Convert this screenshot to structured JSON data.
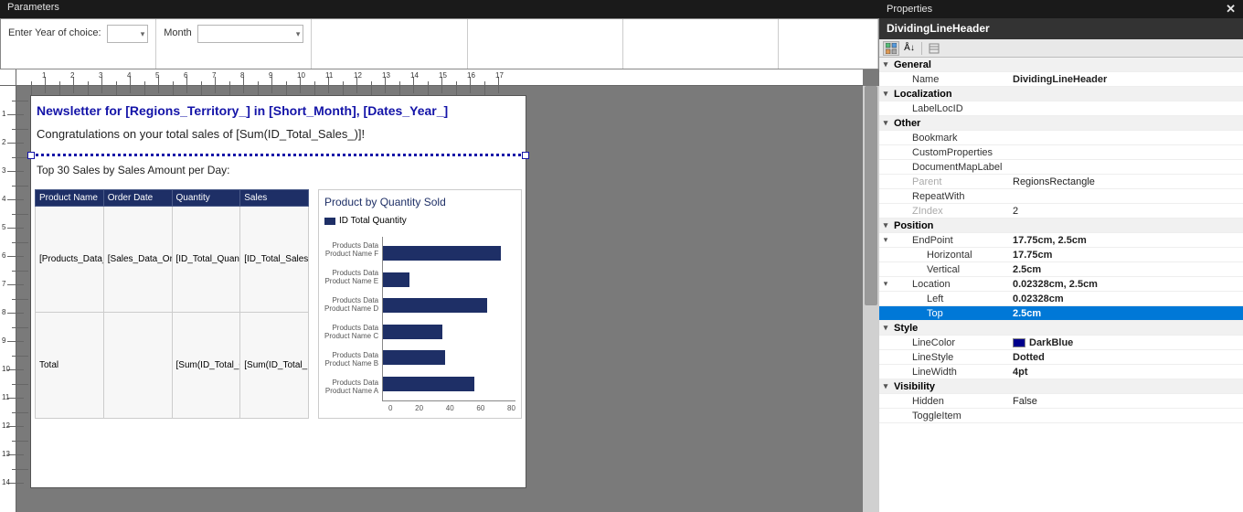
{
  "header": {
    "parameters": "Parameters",
    "properties": "Properties"
  },
  "propertiesObject": "DividingLineHeader",
  "params": [
    {
      "label": "Enter Year of choice:",
      "value": ""
    },
    {
      "label": "Month",
      "value": ""
    }
  ],
  "page": {
    "title": "Newsletter for [Regions_Territory_] in [Short_Month], [Dates_Year_]",
    "congrats": "Congratulations on your total sales of [Sum(ID_Total_Sales_)]!",
    "section": "Top 30 Sales by Sales Amount per Day:"
  },
  "table": {
    "headers": [
      "Product Name",
      "Order Date",
      "Quantity",
      "Sales"
    ],
    "row1": [
      "[Products_Data_",
      "[Sales_Data_Or",
      "[ID_Total_Quant",
      "[ID_Total_Sales"
    ],
    "row2": [
      "Total",
      "",
      "[Sum(ID_Total_Q",
      "[Sum(ID_Total_"
    ]
  },
  "chart_data": {
    "type": "bar",
    "orientation": "horizontal",
    "title": "Product by Quantity Sold",
    "legend": [
      "ID Total Quantity"
    ],
    "categories": [
      "Products Data Product Name F",
      "Products Data Product Name E",
      "Products Data Product Name D",
      "Products Data Product Name C",
      "Products Data Product Name B",
      "Products Data Product Name A"
    ],
    "values": [
      80,
      18,
      71,
      40,
      42,
      62
    ],
    "xticks": [
      0,
      20,
      40,
      60,
      80
    ],
    "xlim": [
      0,
      90
    ],
    "xlabel": "",
    "ylabel": ""
  },
  "props": {
    "categories": {
      "general": "General",
      "localization": "Localization",
      "other": "Other",
      "position": "Position",
      "style": "Style",
      "visibility": "Visibility"
    },
    "items": {
      "Name": "DividingLineHeader",
      "LabelLocID": "",
      "Bookmark": "",
      "CustomProperties": "",
      "DocumentMapLabel": "",
      "Parent": "RegionsRectangle",
      "RepeatWith": "",
      "ZIndex": "2",
      "EndPoint": "17.75cm, 2.5cm",
      "EndPoint_Horizontal": "17.75cm",
      "EndPoint_Vertical": "2.5cm",
      "Location": "0.02328cm, 2.5cm",
      "Location_Left": "0.02328cm",
      "Location_Top": "2.5cm",
      "LineColor": "DarkBlue",
      "LineColor_hex": "#00008b",
      "LineStyle": "Dotted",
      "LineWidth": "4pt",
      "Hidden": "False",
      "ToggleItem": ""
    },
    "selected": "Location_Top"
  },
  "ruler": {
    "h": [
      1,
      2,
      3,
      4,
      5,
      6,
      7,
      8,
      9,
      10,
      11,
      12,
      13,
      14,
      15,
      16,
      17
    ],
    "v": [
      1,
      2,
      3,
      4,
      5,
      6,
      7,
      8,
      9,
      10,
      11,
      12,
      13,
      14
    ]
  }
}
